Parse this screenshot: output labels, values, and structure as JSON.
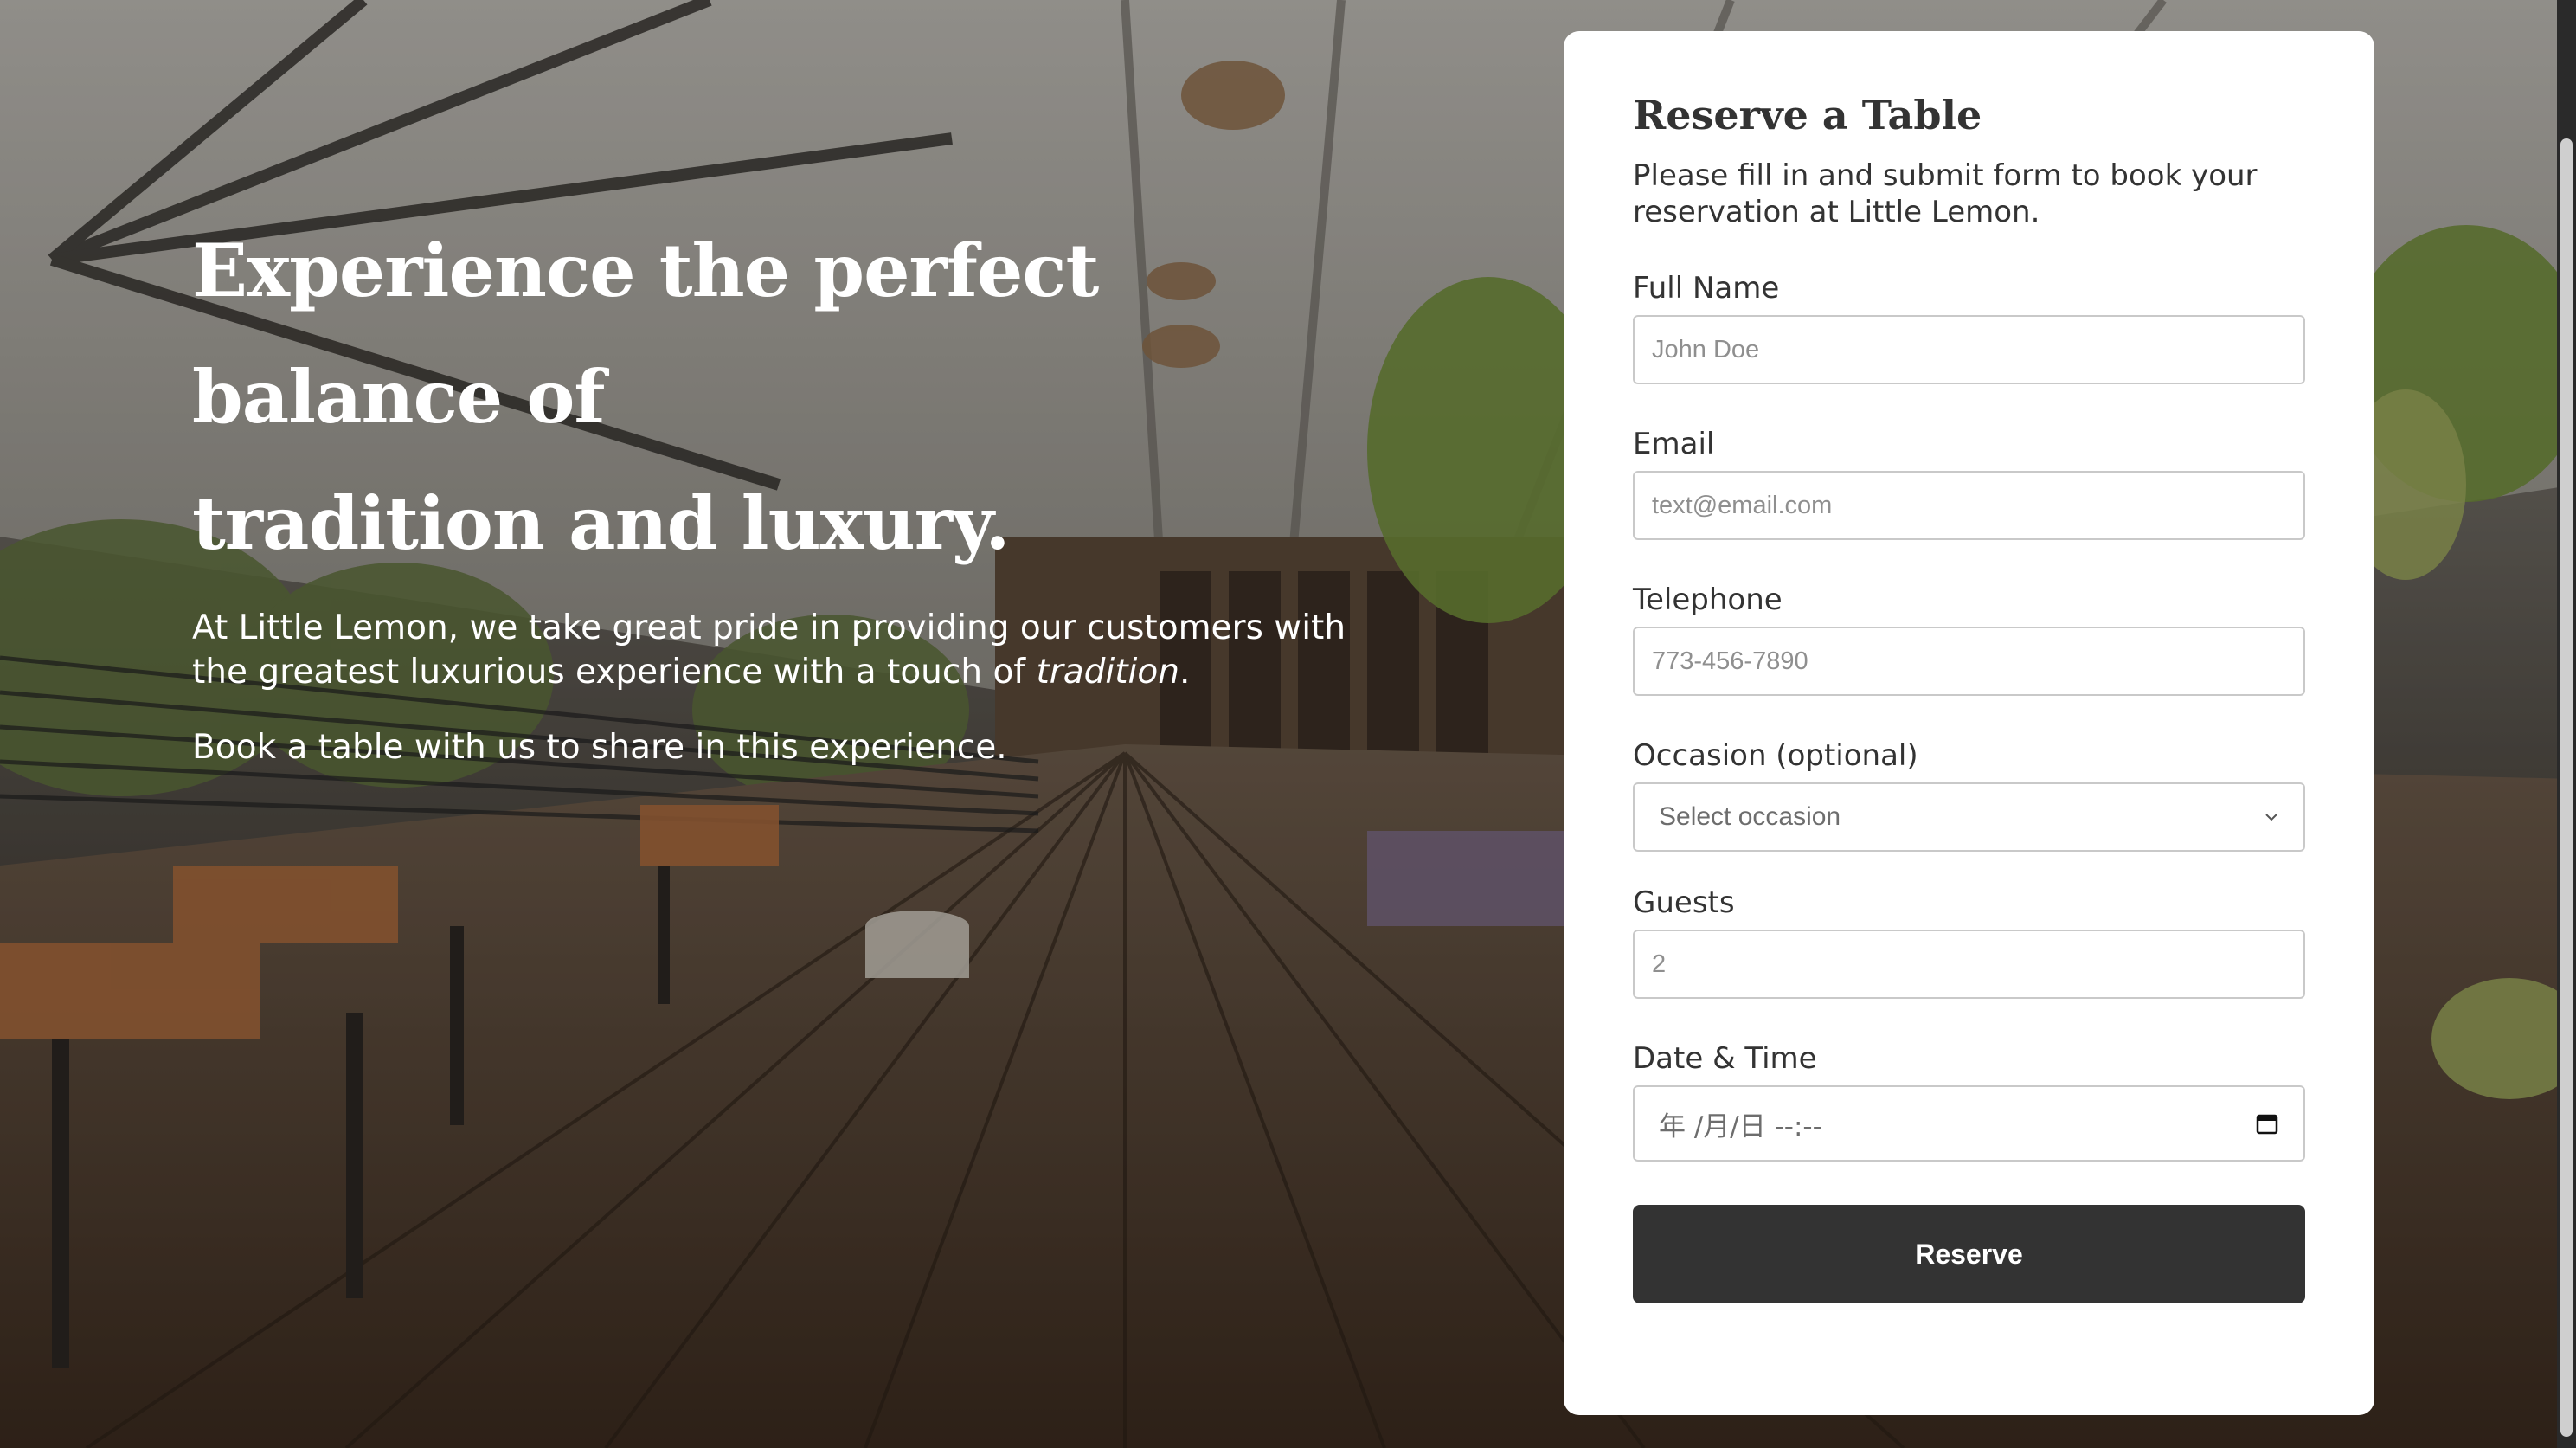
{
  "hero": {
    "title_line1": "Experience the perfect balance of",
    "title_line2": "tradition and luxury.",
    "paragraph_before": "At Little Lemon, we take great pride in providing our customers with the greatest luxurious experience with a touch of ",
    "paragraph_italic": "tradition",
    "paragraph_after": ".",
    "paragraph2": "Book a table with us to share in this experience."
  },
  "form": {
    "title": "Reserve a Table",
    "description": "Please fill in and submit form to book your reservation at Little Lemon.",
    "full_name": {
      "label": "Full Name",
      "placeholder": "John Doe",
      "value": ""
    },
    "email": {
      "label": "Email",
      "placeholder": "text@email.com",
      "value": ""
    },
    "telephone": {
      "label": "Telephone",
      "placeholder": "773-456-7890",
      "value": ""
    },
    "occasion": {
      "label": "Occasion (optional)",
      "selected": "Select occasion"
    },
    "guests": {
      "label": "Guests",
      "placeholder": "2",
      "value": ""
    },
    "datetime": {
      "label": "Date & Time",
      "placeholder": "年 /月/日 --:--"
    },
    "submit_label": "Reserve"
  },
  "colors": {
    "card_bg": "#ffffff",
    "text_dark": "#333333",
    "button_bg": "#333333",
    "button_text": "#ffffff",
    "input_border": "#c9c9c9"
  },
  "icons": {
    "select_chevron": "chevron-down-icon",
    "date_picker": "calendar-icon"
  }
}
